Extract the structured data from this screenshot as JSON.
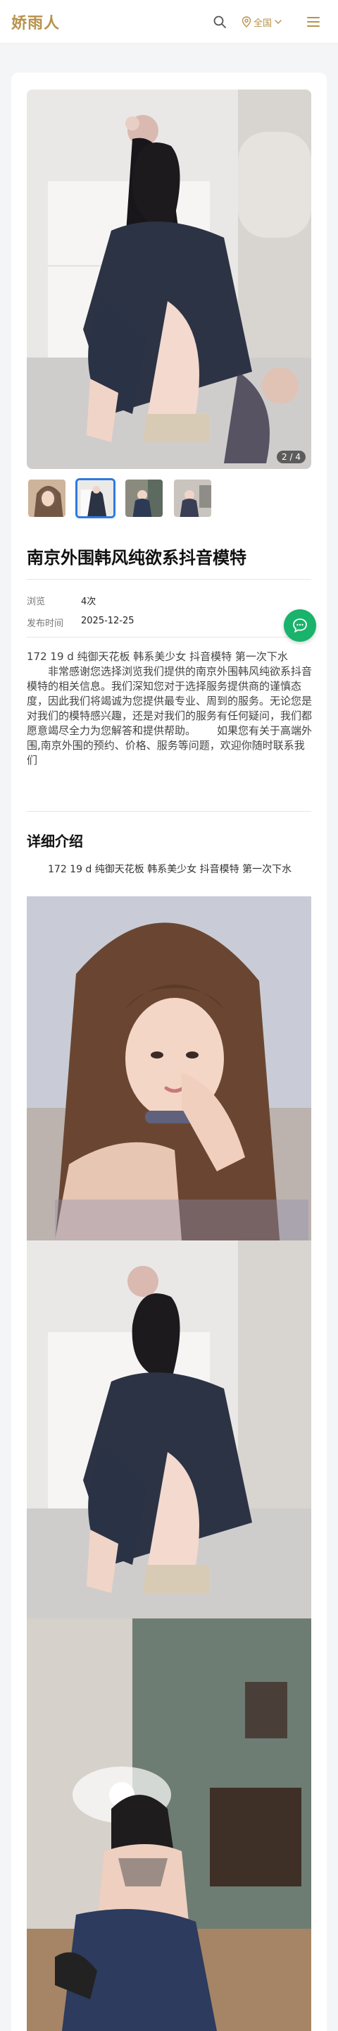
{
  "header": {
    "logo_text": "娇雨人",
    "region_label": "全国",
    "icons": [
      "search-icon",
      "location-pin-icon",
      "chevron-down-icon",
      "menu-icon"
    ],
    "accent_color": "#b8924a"
  },
  "gallery": {
    "counter": "2 / 4",
    "thumbnail_count": 4,
    "active_thumbnail": 2,
    "active_color": "#2d7be0"
  },
  "post": {
    "title": "南京外围韩风纯欲系抖音模特",
    "views_label": "浏览",
    "views_value": "4次",
    "published_label": "发布时间",
    "published_value": "2025-12-25",
    "summary_line": "172 19 d 纯御天花板 韩系美少女 抖音模特 第一次下水",
    "summary_body": "非常感谢您选择浏览我们提供的南京外围韩风纯欲系抖音模特的相关信息。我们深知您对于选择服务提供商的谨慎态度，因此我们将竭诚为您提供最专业、周到的服务。无论您是对我们的模特感兴趣，还是对我们的服务有任何疑问，我们都愿意竭尽全力为您解答和提供帮助。",
    "summary_contact": "如果您有关于高端外围,南京外围的预约、价格、服务等问题，欢迎你随时联系我们"
  },
  "details": {
    "section_title": "详细介绍",
    "text": "172 19 d 纯御天花板 韩系美少女 抖音模特 第一次下水",
    "photo_count": 3
  },
  "chat_button": {
    "icon": "chat-bubble-icon",
    "color": "#19b36b"
  }
}
